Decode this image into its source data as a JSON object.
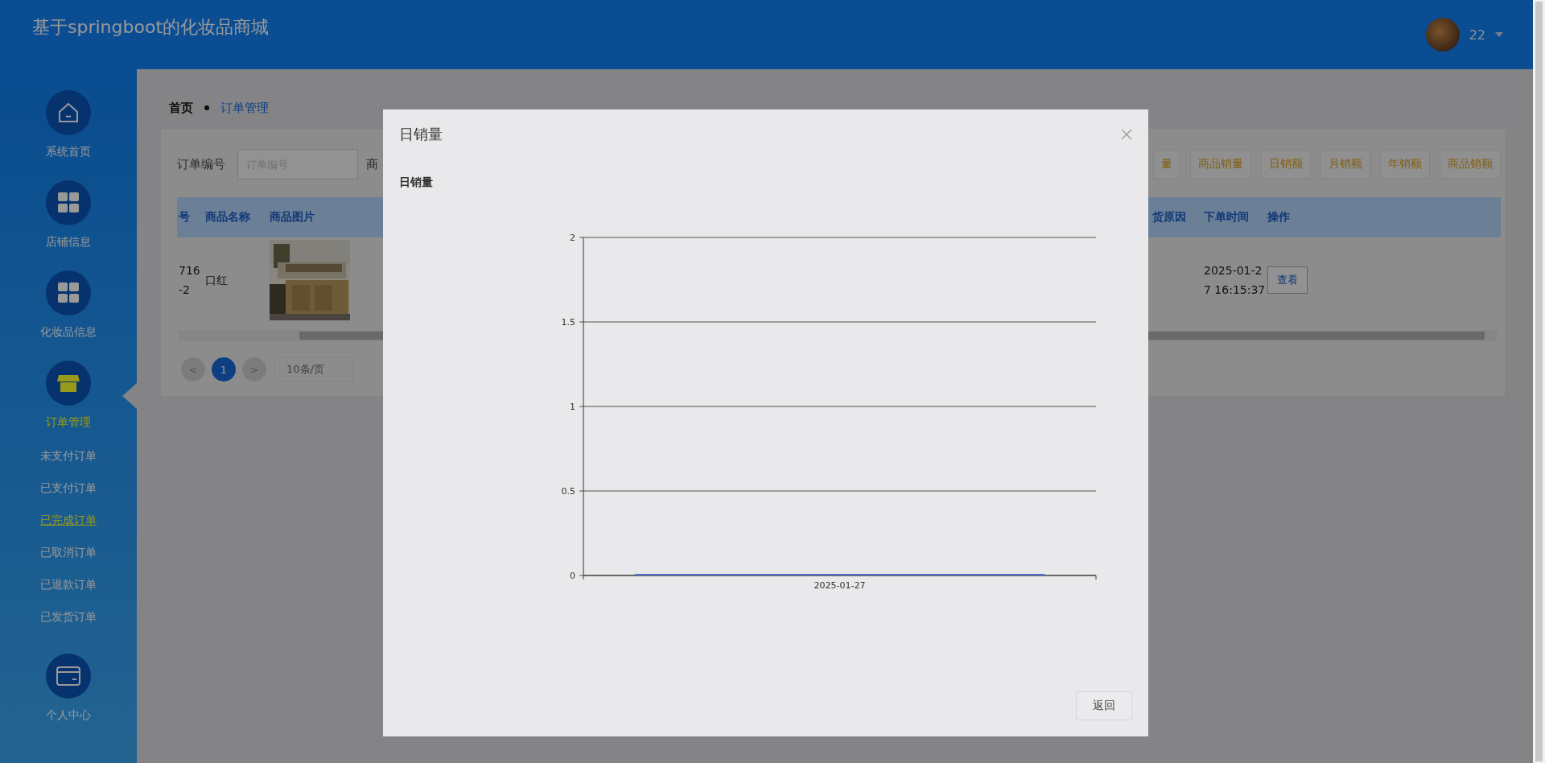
{
  "header": {
    "title": "基于springboot的化妆品商城",
    "user": "22"
  },
  "sidebar": {
    "items": [
      {
        "label": "系统首页",
        "kind": "home",
        "selected": false
      },
      {
        "label": "店铺信息",
        "kind": "grid",
        "selected": false
      },
      {
        "label": "化妆品信息",
        "kind": "grid",
        "selected": false
      },
      {
        "label": "订单管理",
        "kind": "shop",
        "selected": true,
        "children": [
          {
            "label": "未支付订单",
            "selected": false
          },
          {
            "label": "已支付订单",
            "selected": false
          },
          {
            "label": "已完成订单",
            "selected": true
          },
          {
            "label": "已取消订单",
            "selected": false
          },
          {
            "label": "已退款订单",
            "selected": false
          },
          {
            "label": "已发货订单",
            "selected": false
          }
        ]
      },
      {
        "label": "个人中心",
        "kind": "card",
        "selected": false
      }
    ]
  },
  "breadcrumb": [
    "首页",
    "订单管理"
  ],
  "search": {
    "label": "订单编号",
    "placeholder": "订单编号",
    "label_2": "商"
  },
  "stat_buttons": [
    "量",
    "商品销量",
    "日销额",
    "月销额",
    "年销额",
    "商品销额"
  ],
  "table": {
    "columns": [
      "号",
      "商品名称",
      "商品图片",
      "货原因",
      "下单时间",
      "操作"
    ],
    "rows": [
      {
        "order_no": [
          "716",
          "-2"
        ],
        "name": "口红",
        "time": [
          "2025-01-2",
          "7 16:15:37"
        ],
        "action": "查看"
      }
    ]
  },
  "pagination": {
    "prev": "<",
    "pages": [
      {
        "label": "1",
        "selected": true
      }
    ],
    "next": ">",
    "page_size": "10条/页"
  },
  "modal": {
    "title": "日销量",
    "chart_data": {
      "type": "bar",
      "title": "日销量",
      "grid": true,
      "categories": [
        "2025-01-27"
      ],
      "values": [
        0
      ],
      "ylim": [
        0,
        2
      ],
      "yticks": [
        0,
        0.5,
        1,
        1.5,
        2
      ]
    },
    "button": "返回"
  }
}
